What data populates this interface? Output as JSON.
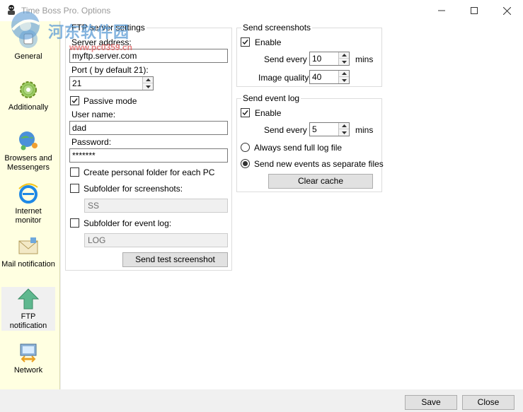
{
  "window": {
    "title": "Time Boss Pro. Options",
    "watermark_text": "河东软件园",
    "watermark_url": "www.pc0359.cn"
  },
  "sidebar": {
    "items": [
      {
        "label": "General",
        "icon": "general-icon"
      },
      {
        "label": "Additionally",
        "icon": "gear-icon"
      },
      {
        "label": "Browsers and Messengers",
        "icon": "globe-people-icon"
      },
      {
        "label": "Internet monitor",
        "icon": "internet-explorer-icon"
      },
      {
        "label": "Mail notification",
        "icon": "envelope-icon"
      },
      {
        "label": "FTP notification",
        "icon": "up-arrow-icon",
        "selected": true
      },
      {
        "label": "Network",
        "icon": "network-icon"
      }
    ]
  },
  "ftp": {
    "group_title": "FTP server settings",
    "server_label": "Server address:",
    "server_value": "myftp.server.com",
    "port_label": "Port  ( by default 21):",
    "port_value": "21",
    "passive_label": "Passive mode",
    "passive_checked": true,
    "user_label": "User name:",
    "user_value": "dad",
    "password_label": "Password:",
    "password_value": "*******",
    "personal_folder_label": "Create personal folder for each PC",
    "personal_folder_checked": false,
    "sub_screens_label": "Subfolder for screenshots:",
    "sub_screens_checked": false,
    "sub_screens_value": "SS",
    "sub_log_label": "Subfolder for event log:",
    "sub_log_checked": false,
    "sub_log_value": "LOG",
    "test_button": "Send test screenshot"
  },
  "screenshots": {
    "group_title": "Send screenshots",
    "enable_label": "Enable",
    "enable_checked": true,
    "send_every_label": "Send every",
    "send_every_value": "10",
    "mins_label": "mins",
    "quality_label": "Image quality",
    "quality_value": "40"
  },
  "eventlog": {
    "group_title": "Send event log",
    "enable_label": "Enable",
    "enable_checked": true,
    "send_every_label": "Send every",
    "send_every_value": "5",
    "mins_label": "mins",
    "full_log_label": "Always send full log file",
    "full_log_selected": false,
    "new_events_label": "Send new events as separate files",
    "new_events_selected": true,
    "clear_cache_button": "Clear cache"
  },
  "footer": {
    "save_button": "Save",
    "close_button": "Close"
  }
}
